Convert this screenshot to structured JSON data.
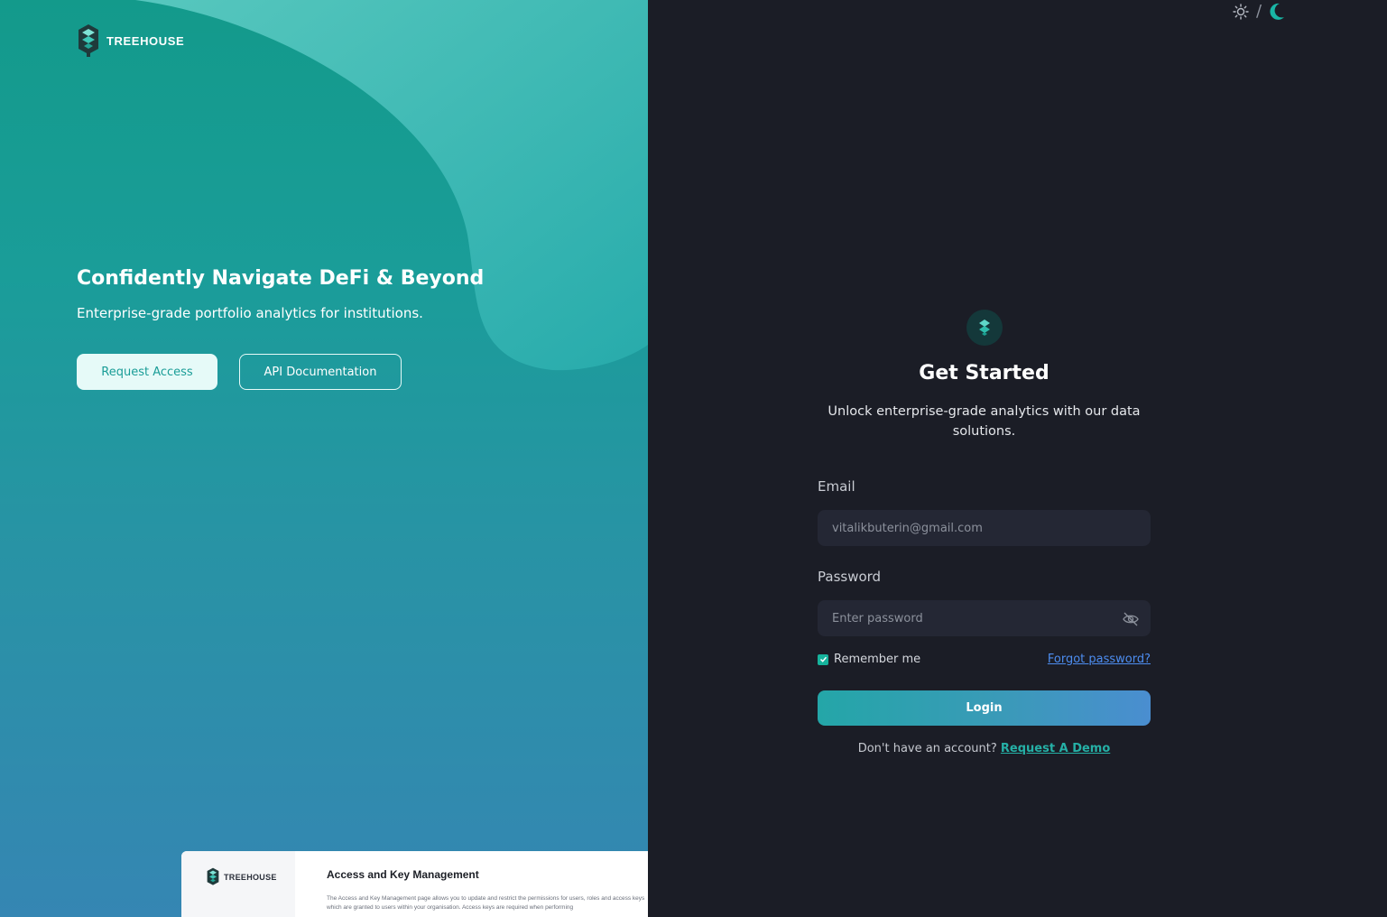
{
  "brand": {
    "name": "TREEHOUSE"
  },
  "hero": {
    "title": "Confidently Navigate DeFi & Beyond",
    "subtitle": "Enterprise-grade portfolio analytics for institutions.",
    "primary_button": "Request Access",
    "secondary_button": "API Documentation"
  },
  "preview": {
    "brand": "TREEHOUSE",
    "title": "Access and Key Management",
    "body": "The Access and Key Management page allows you to update and restrict the permissions for users, roles and access keys which are granted to users within your organisation. Access keys are required when performing"
  },
  "theme_toggle": {
    "separator": "/",
    "icons": [
      "sun-icon",
      "moon-icon"
    ],
    "active": "dark"
  },
  "form": {
    "title": "Get Started",
    "subtitle": "Unlock enterprise-grade analytics with our data solutions.",
    "email_label": "Email",
    "email_placeholder": "vitalikbuterin@gmail.com",
    "password_label": "Password",
    "password_placeholder": "Enter password",
    "remember_label": "Remember me",
    "remember_checked": true,
    "forgot_link": "Forgot password?",
    "login_button": "Login",
    "signup_prompt": "Don't have an account?",
    "signup_link": "Request A Demo"
  },
  "colors": {
    "accent": "#16b39c",
    "link": "#4d8df0",
    "panel_dark": "#1b1d26",
    "input_bg": "#242734"
  }
}
